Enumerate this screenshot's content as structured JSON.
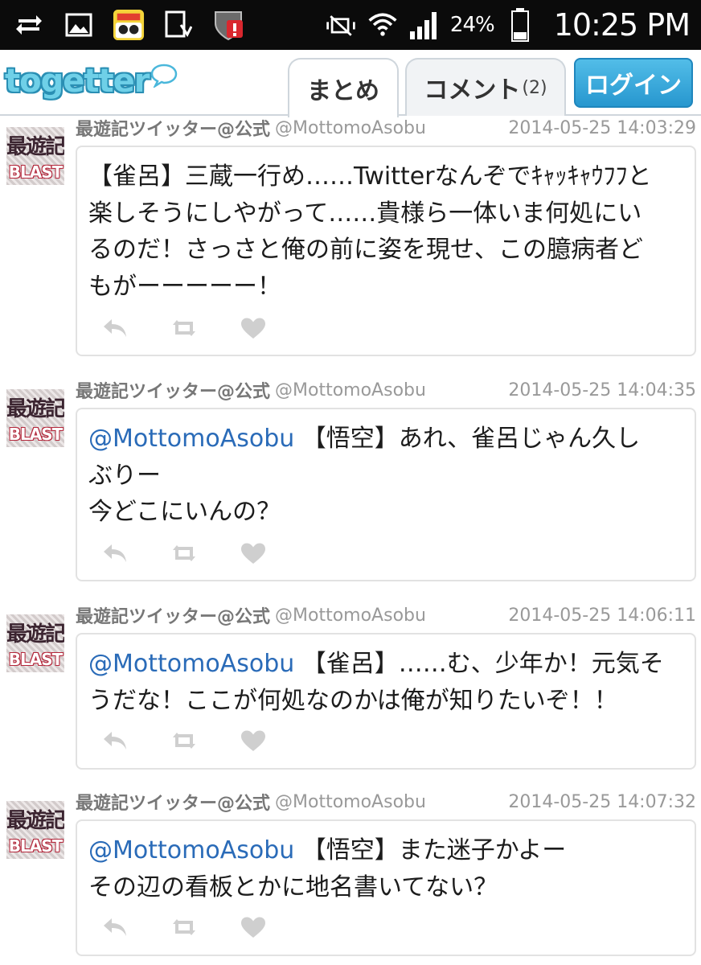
{
  "status_bar": {
    "battery_percent": "24%",
    "time": "10:25 PM",
    "icons": [
      "sync-icon",
      "gallery-icon",
      "app-icon",
      "download-icon",
      "shield-alert-icon",
      "mute-icon",
      "wifi-icon",
      "signal-icon",
      "battery-icon"
    ]
  },
  "header": {
    "logo": "togetter",
    "tabs": [
      {
        "label": "まとめ",
        "active": true
      },
      {
        "label": "コメント",
        "count": "(2)",
        "active": false
      }
    ],
    "login_label": "ログイン"
  },
  "tweets": [
    {
      "author": "最遊記ツイッター@公式",
      "handle": "@MottomoAsobu",
      "timestamp": "2014-05-25 14:03:29",
      "mention": "",
      "lines": [
        "【雀呂】三蔵一行め……Twitterなんぞでｷｬｯｷｬｳﾌﾌと",
        "楽しそうにしやがって……貴様ら一体いま何処にい",
        "るのだ！さっさと俺の前に姿を現せ、この臆病者ど",
        "もがーーーーー！"
      ]
    },
    {
      "author": "最遊記ツイッター@公式",
      "handle": "@MottomoAsobu",
      "timestamp": "2014-05-25 14:04:35",
      "mention": "@MottomoAsobu",
      "lines": [
        " 【悟空】あれ、雀呂じゃん久し",
        "ぶりー",
        "今どこにいんの？"
      ]
    },
    {
      "author": "最遊記ツイッター@公式",
      "handle": "@MottomoAsobu",
      "timestamp": "2014-05-25 14:06:11",
      "mention": "@MottomoAsobu",
      "lines": [
        " 【雀呂】……む、少年か！元気そ",
        "うだな！ここが何処なのかは俺が知りたいぞ！！"
      ]
    },
    {
      "author": "最遊記ツイッター@公式",
      "handle": "@MottomoAsobu",
      "timestamp": "2014-05-25 14:07:32",
      "mention": "@MottomoAsobu",
      "lines": [
        " 【悟空】また迷子かよー",
        "その辺の看板とかに地名書いてない？"
      ]
    }
  ],
  "avatar": {
    "top_text": "最遊記",
    "bottom_text": "BLAST"
  },
  "colors": {
    "mention": "#2a6bb8",
    "login": "#2797cf",
    "logo": "#6fd0e8"
  }
}
